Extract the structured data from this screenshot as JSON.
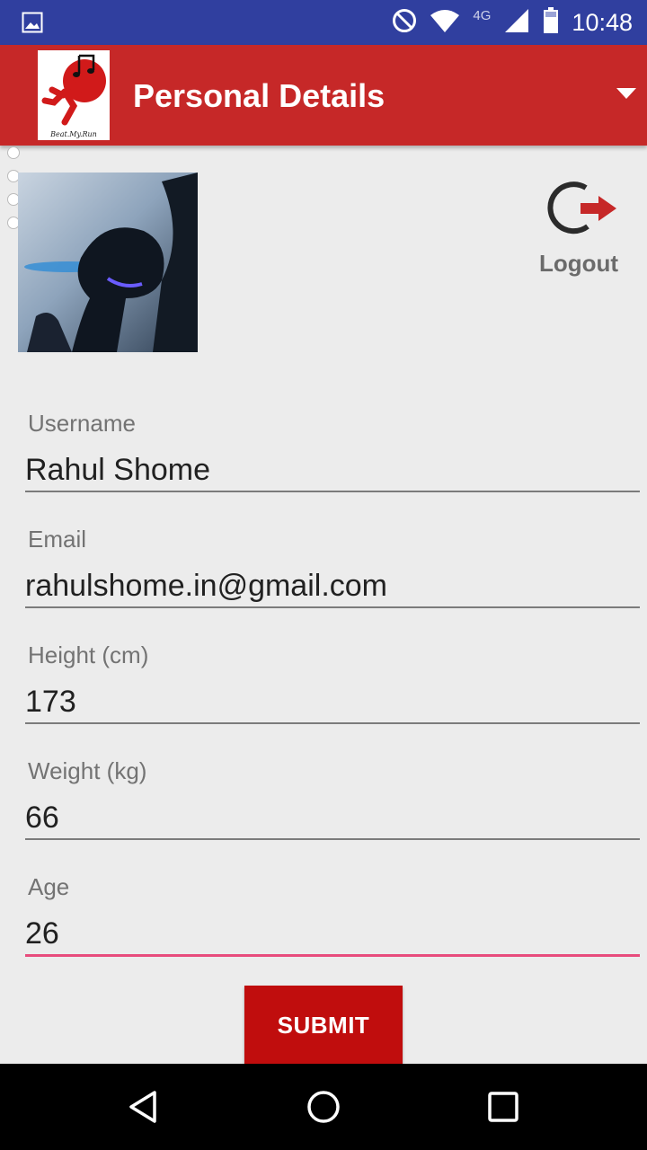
{
  "status_bar": {
    "time": "10:48",
    "network": "4G",
    "icons": [
      "image-icon",
      "do-not-disturb-icon",
      "wifi-icon",
      "signal-icon",
      "battery-icon"
    ]
  },
  "app_bar": {
    "title": "Personal Details",
    "logo_caption": "Beat.My.Run"
  },
  "profile": {
    "logout_label": "Logout"
  },
  "form": {
    "fields": [
      {
        "label": "Username",
        "value": "Rahul Shome"
      },
      {
        "label": "Email",
        "value": "rahulshome.in@gmail.com"
      },
      {
        "label": "Height (cm)",
        "value": "173"
      },
      {
        "label": "Weight (kg)",
        "value": "66"
      },
      {
        "label": "Age",
        "value": "26"
      }
    ],
    "submit_label": "SUBMIT"
  },
  "colors": {
    "status_bar": "#303f9f",
    "app_bar": "#c62828",
    "submit": "#c00d0d",
    "active_underline": "#e84c7d"
  },
  "nav_bar": {
    "icons": [
      "back-icon",
      "home-icon",
      "recents-icon"
    ]
  }
}
